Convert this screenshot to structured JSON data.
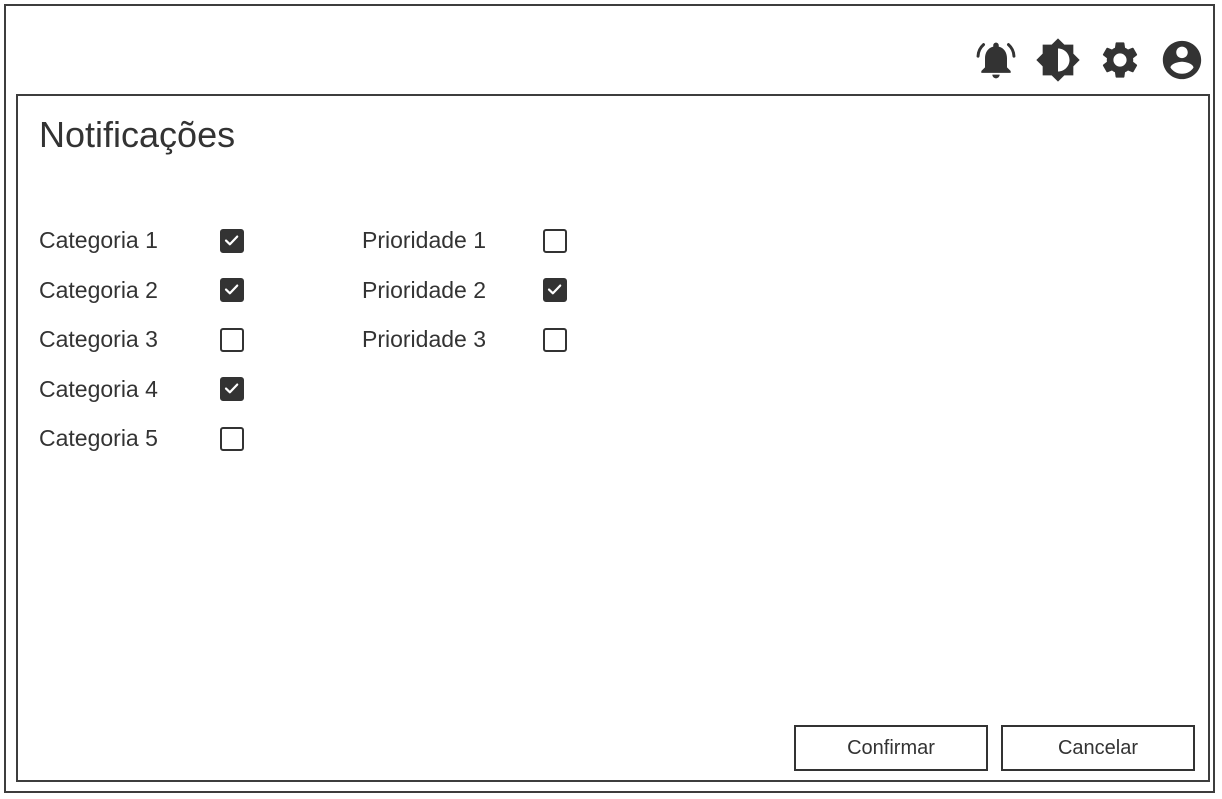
{
  "toolbar": {
    "icons": [
      "notification-bell-icon",
      "brightness-icon",
      "settings-gear-icon",
      "account-circle-icon"
    ],
    "icon_color": "#333333"
  },
  "panel": {
    "title": "Notificações"
  },
  "categories": [
    {
      "label": "Categoria 1",
      "checked": true
    },
    {
      "label": "Categoria 2",
      "checked": true
    },
    {
      "label": "Categoria 3",
      "checked": false
    },
    {
      "label": "Categoria 4",
      "checked": true
    },
    {
      "label": "Categoria 5",
      "checked": false
    }
  ],
  "priorities": [
    {
      "label": "Prioridade 1",
      "checked": false
    },
    {
      "label": "Prioridade 2",
      "checked": true
    },
    {
      "label": "Prioridade 3",
      "checked": false
    }
  ],
  "actions": {
    "confirm_label": "Confirmar",
    "cancel_label": "Cancelar"
  },
  "colors": {
    "border": "#3d3d3d",
    "text": "#333333",
    "checked_fill": "#333333"
  }
}
